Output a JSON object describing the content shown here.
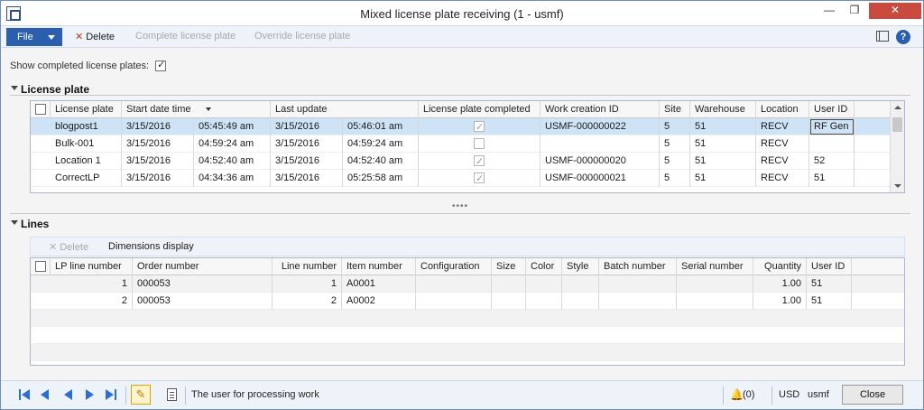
{
  "window": {
    "title": "Mixed license plate receiving (1 - usmf)",
    "min_glyph": "—",
    "max_glyph": "❐",
    "close_glyph": "✕"
  },
  "actions": {
    "file": "File",
    "delete": "Delete",
    "complete": "Complete license plate",
    "override": "Override license plate",
    "help": "?"
  },
  "show_completed": {
    "label": "Show completed license plates:",
    "checked": true
  },
  "license_plate": {
    "section": "License plate",
    "columns": [
      "License plate",
      "Start date time",
      "Last update",
      "License plate completed",
      "Work creation ID",
      "Site",
      "Warehouse",
      "Location",
      "User ID"
    ],
    "rows": [
      {
        "plate": "blogpost1",
        "start_date": "3/15/2016",
        "start_time": "05:45:49 am",
        "upd_date": "3/15/2016",
        "upd_time": "05:46:01 am",
        "completed": true,
        "work_id": "USMF-000000022",
        "site": "5",
        "warehouse": "51",
        "location": "RECV",
        "user": "RF Gen"
      },
      {
        "plate": "Bulk-001",
        "start_date": "3/15/2016",
        "start_time": "04:59:24 am",
        "upd_date": "3/15/2016",
        "upd_time": "04:59:24 am",
        "completed": false,
        "work_id": "",
        "site": "5",
        "warehouse": "51",
        "location": "RECV",
        "user": ""
      },
      {
        "plate": "Location 1",
        "start_date": "3/15/2016",
        "start_time": "04:52:40 am",
        "upd_date": "3/15/2016",
        "upd_time": "04:52:40 am",
        "completed": true,
        "work_id": "USMF-000000020",
        "site": "5",
        "warehouse": "51",
        "location": "RECV",
        "user": "52"
      },
      {
        "plate": "CorrectLP",
        "start_date": "3/15/2016",
        "start_time": "04:34:36 am",
        "upd_date": "3/15/2016",
        "upd_time": "05:25:58 am",
        "completed": true,
        "work_id": "USMF-000000021",
        "site": "5",
        "warehouse": "51",
        "location": "RECV",
        "user": "51"
      }
    ]
  },
  "lines": {
    "section": "Lines",
    "delete": "Delete",
    "dimensions": "Dimensions display",
    "columns": [
      "LP line number",
      "Order number",
      "Line number",
      "Item number",
      "Configuration",
      "Size",
      "Color",
      "Style",
      "Batch number",
      "Serial number",
      "Quantity",
      "User ID"
    ],
    "rows": [
      {
        "lp_line": "1",
        "order": "000053",
        "line": "1",
        "item": "A0001",
        "qty": "1.00",
        "user": "51"
      },
      {
        "lp_line": "2",
        "order": "000053",
        "line": "2",
        "item": "A0002",
        "qty": "1.00",
        "user": "51"
      }
    ]
  },
  "status": {
    "help_text": "The user for processing work",
    "notifications": "(0)",
    "currency": "USD",
    "company": "usmf",
    "close": "Close"
  },
  "colors": {
    "accent": "#2b5fae",
    "selected_row": "#cfe3f7",
    "nav_blue": "#2b6fd6",
    "close_red": "#c94a3e"
  }
}
